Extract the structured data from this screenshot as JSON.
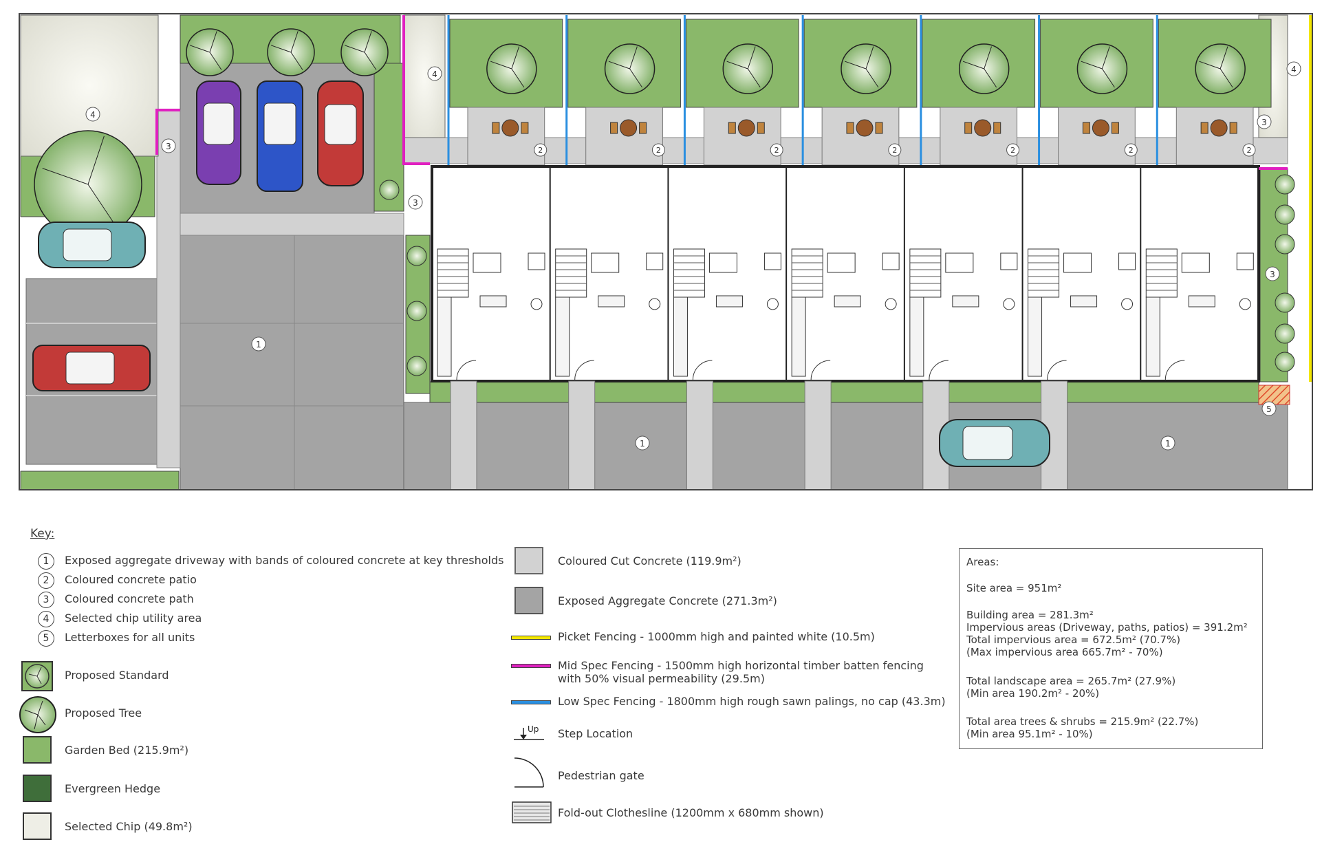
{
  "key": {
    "title": "Key:",
    "numbered": [
      {
        "num": "1",
        "text": "Exposed aggregate driveway with bands of coloured concrete at key thresholds"
      },
      {
        "num": "2",
        "text": "Coloured concrete patio"
      },
      {
        "num": "3",
        "text": "Coloured concrete path"
      },
      {
        "num": "4",
        "text": "Selected chip utility area"
      },
      {
        "num": "5",
        "text": "Letterboxes for all units"
      }
    ],
    "planting": [
      {
        "icon": "proposed-standard-icon",
        "text": "Proposed Standard"
      },
      {
        "icon": "proposed-tree-icon",
        "text": "Proposed Tree"
      },
      {
        "icon": "garden-bed-swatch",
        "text": "Garden Bed (215.9m²)"
      },
      {
        "icon": "evergreen-hedge-swatch",
        "text": "Evergreen Hedge"
      },
      {
        "icon": "selected-chip-swatch",
        "text": "Selected Chip (49.8m²)"
      }
    ],
    "materials": [
      {
        "icon": "coloured-cut-concrete-swatch",
        "text": "Coloured Cut Concrete (119.9m²)"
      },
      {
        "icon": "exposed-aggregate-swatch",
        "text": "Exposed Aggregate Concrete (271.3m²)"
      },
      {
        "icon": "picket-fence-line",
        "color": "#f2e600",
        "text": "Picket Fencing - 1000mm high and painted white (10.5m)"
      },
      {
        "icon": "mid-spec-fence-line",
        "color": "#e020c0",
        "text": "Mid Spec Fencing - 1500mm high horizontal timber batten fencing",
        "text2": "with 50% visual permeability (29.5m)"
      },
      {
        "icon": "low-spec-fence-line",
        "color": "#2a8fe0",
        "text": "Low Spec Fencing - 1800mm high rough sawn palings, no cap (43.3m)"
      },
      {
        "icon": "step-location-icon",
        "symbol": "Up",
        "text": "Step Location"
      },
      {
        "icon": "pedestrian-gate-icon",
        "text": "Pedestrian gate"
      },
      {
        "icon": "clothesline-icon",
        "text": "Fold-out Clothesline (1200mm x 680mm shown)"
      }
    ]
  },
  "areas": {
    "title": "Areas:",
    "site": "Site area = 951m²",
    "building": "Building area = 281.3m²",
    "impervious": "Impervious areas (Driveway, paths, patios) = 391.2m²",
    "total_impervious": "Total impervious area = 672.5m² (70.7%)",
    "max_impervious": "(Max impervious area 665.7m² - 70%)",
    "total_landscape": "Total landscape area = 265.7m² (27.9%)",
    "min_landscape": "(Min area 190.2m² - 20%)",
    "total_trees": "Total area trees & shrubs = 215.9m² (22.7%)",
    "min_trees": "(Min area 95.1m² - 10%)"
  },
  "plan": {
    "labels": {
      "n1": "1",
      "n2": "2",
      "n3": "3",
      "n4": "4",
      "n5": "5"
    }
  },
  "colors": {
    "garden_bed": "#8ab86a",
    "hedge": "#3f6e3a",
    "chip": "#eeeee6",
    "cut_concrete": "#d2d2d2",
    "exposed_aggregate": "#a4a4a4",
    "picket": "#f2e600",
    "mid_spec": "#e020c0",
    "low_spec": "#2a8fe0"
  }
}
